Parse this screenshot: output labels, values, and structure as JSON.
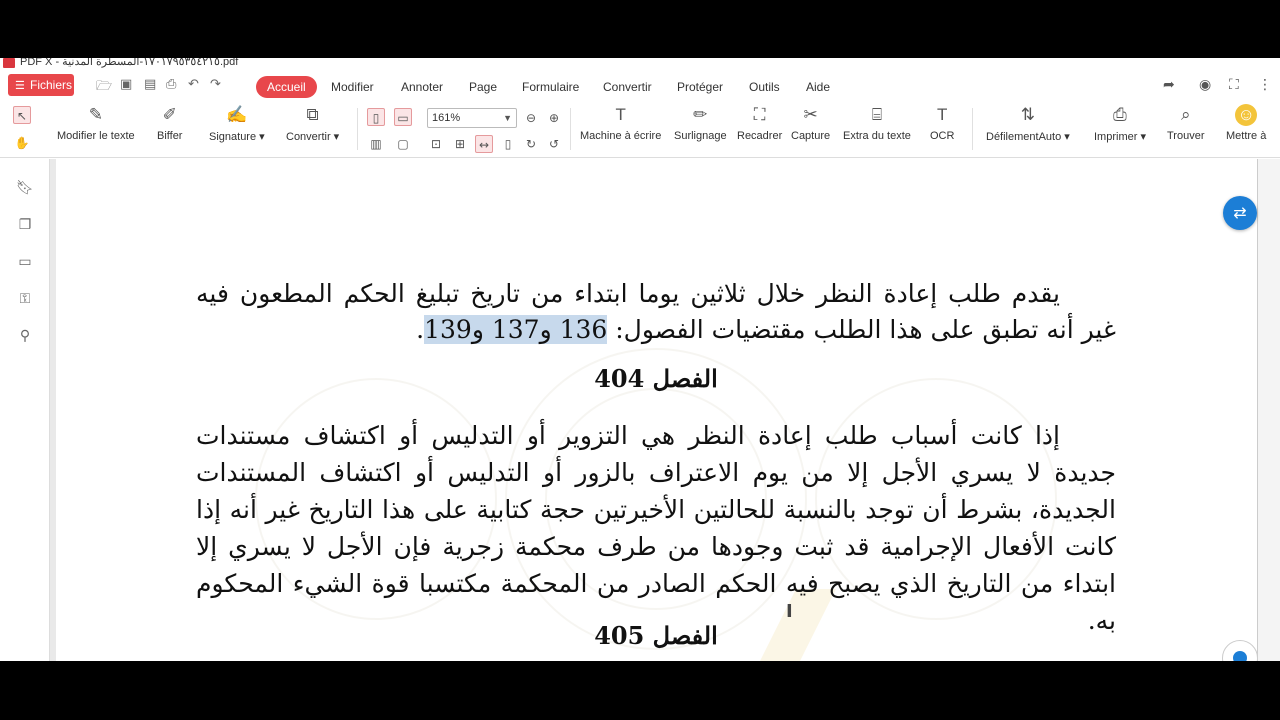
{
  "titlebar": {
    "title": "PDF X - ١٧٠١٧٩٥٣٥٤٢١٥-المسطرة المدنية.pdf"
  },
  "menu": {
    "fichiers": "Fichiers",
    "tabs": [
      "Accueil",
      "Modifier",
      "Annoter",
      "Page",
      "Formulaire",
      "Convertir",
      "Protéger",
      "Outils",
      "Aide"
    ]
  },
  "toolbar": {
    "modifier_texte": "Modifier le texte",
    "biffer": "Biffer",
    "signature": "Signature ▾",
    "convertir": "Convertir ▾",
    "zoom": "161%",
    "machine": "Machine à écrire",
    "surlignage": "Surlignage",
    "recadrer": "Recadrer",
    "capture": "Capture",
    "extra": "Extra du texte",
    "ocr": "OCR",
    "defilement": "DéfilementAuto ▾",
    "imprimer": "Imprimer ▾",
    "trouver": "Trouver",
    "mettre": "Mettre à"
  },
  "document": {
    "para1_pre": "يقدم طلب إعادة النظر خلال ثلاثين يوما ابتداء من تاريخ تبليغ الحكم المطعون فيه غير أنه تطبق على هذا الطلب مقتضيات الفصول: ",
    "para1_hl": "136 و137 و139",
    "para1_post": ".",
    "heading404": "الفصل 404",
    "para2": "إذا كانت أسباب طلب إعادة النظر هي التزوير أو التدليس أو اكتشاف مستندات جديدة لا يسري الأجل إلا من يوم الاعتراف بالزور أو التدليس أو اكتشاف المستندات الجديدة، بشرط أن توجد بالنسبة للحالتين الأخيرتين حجة كتابية على هذا التاريخ غير أنه إذا كانت الأفعال الإجرامية قد ثبت وجودها من طرف محكمة زجرية فإن الأجل لا يسري إلا ابتداء من التاريخ الذي يصبح فيه الحكم الصادر من المحكمة مكتسبا قوة الشيء المحكوم به.",
    "heading405": "الفصل 405"
  }
}
